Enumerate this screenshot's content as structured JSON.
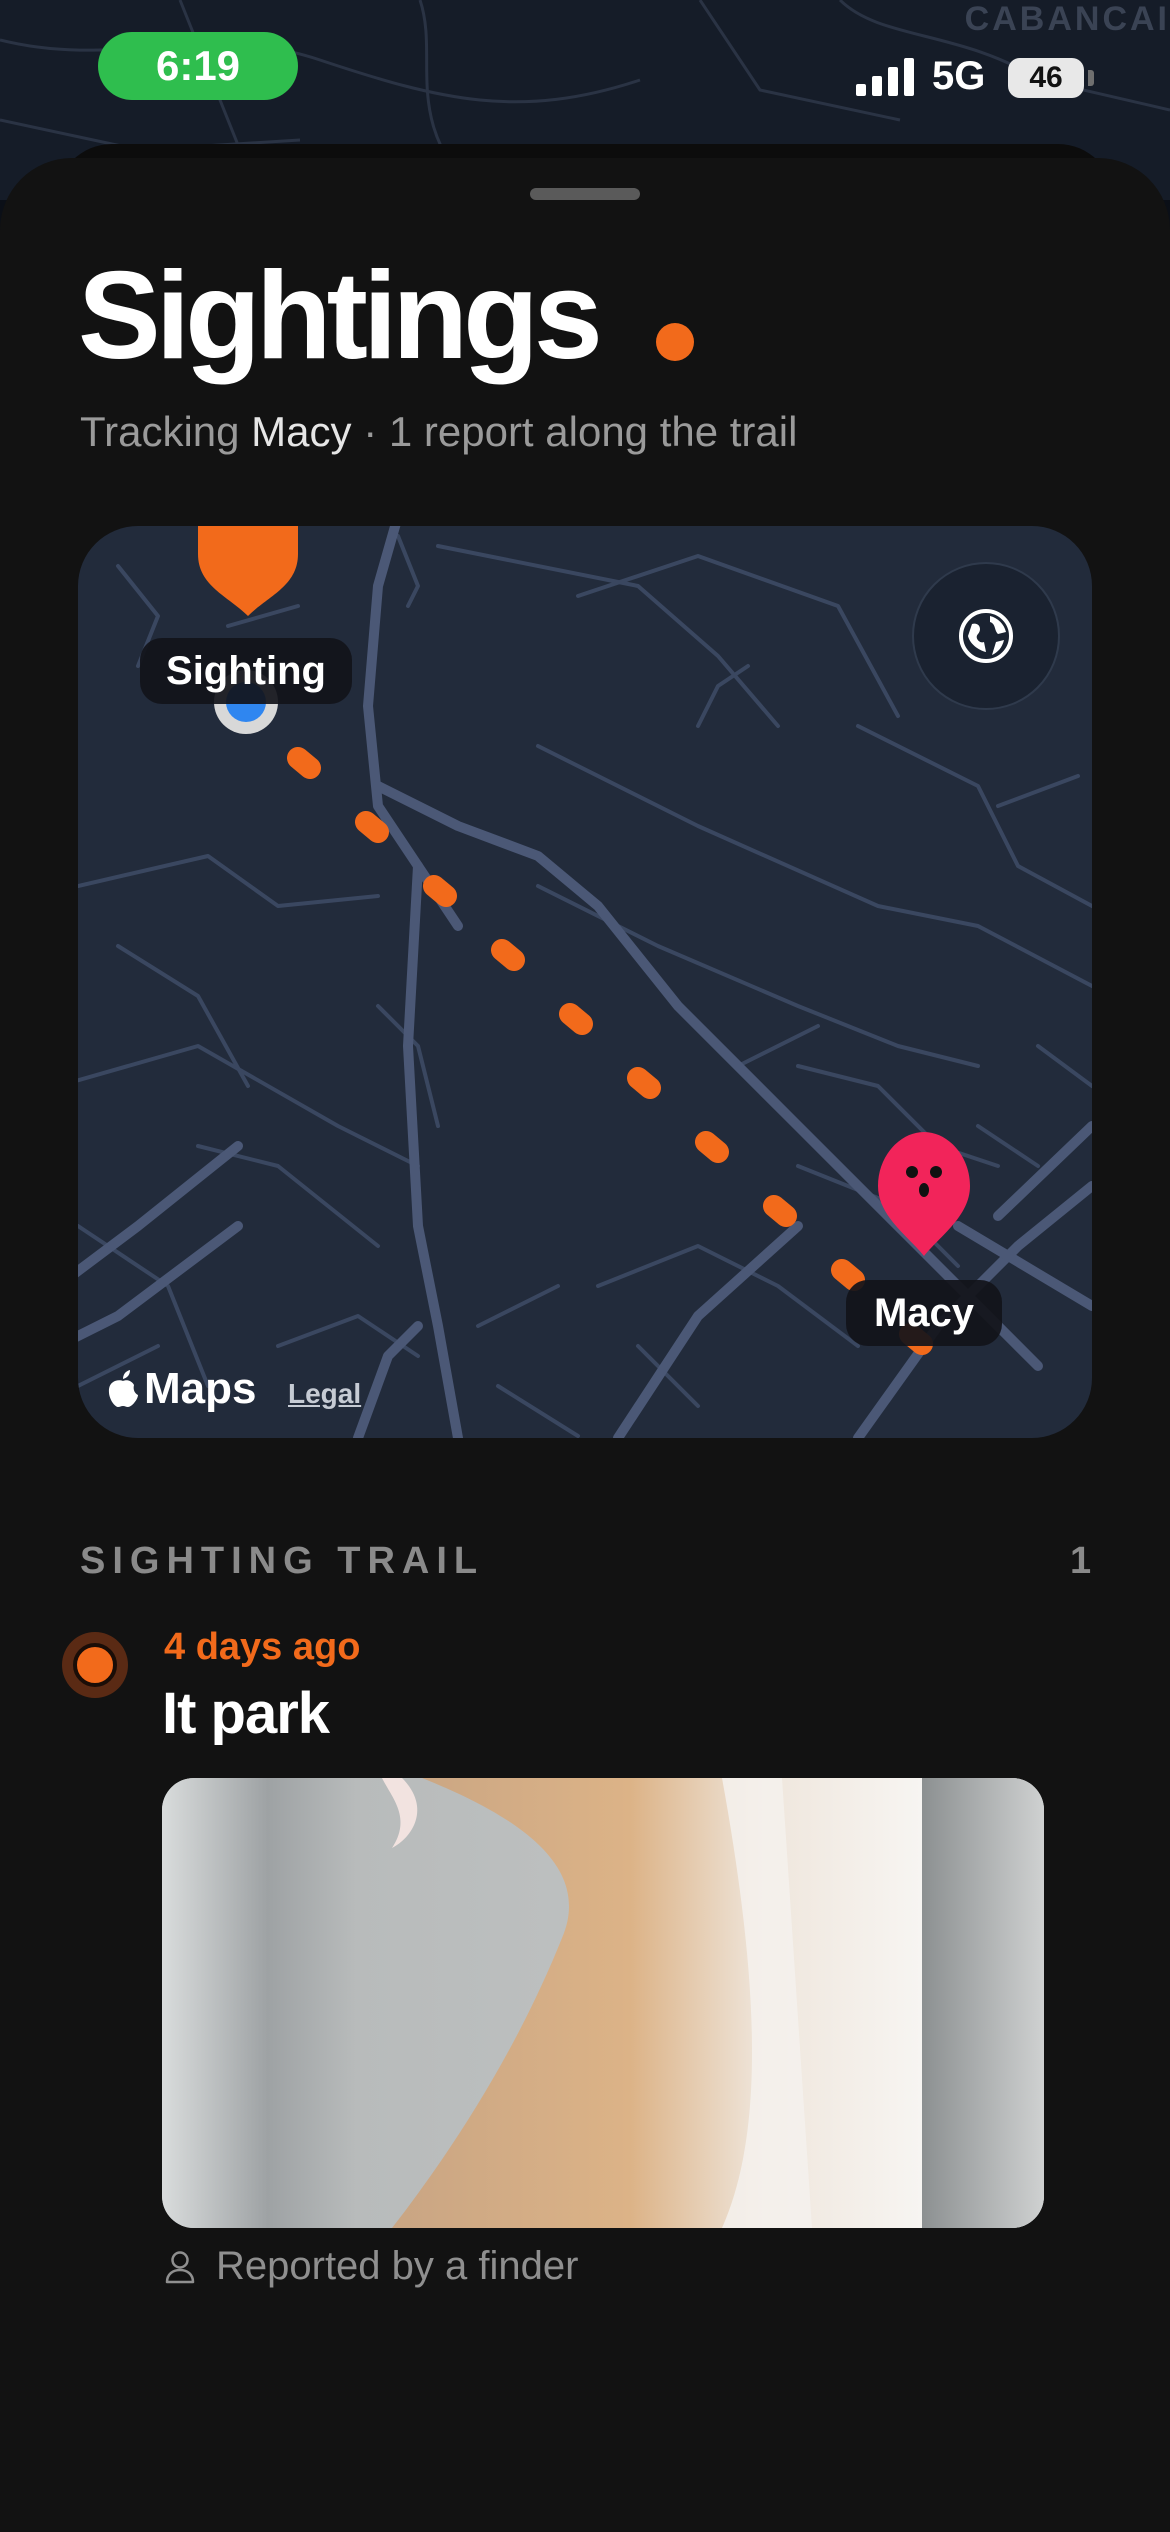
{
  "status_bar": {
    "time": "6:19",
    "network": "5G",
    "battery": "46"
  },
  "background_map": {
    "place_label": "CABANCAI"
  },
  "header": {
    "title": "Sightings",
    "subtitle_prefix": "Tracking ",
    "pet_name": "Macy",
    "subtitle_suffix": " · 1 report along the trail"
  },
  "map": {
    "sighting_label": "Sighting",
    "pet_label": "Macy",
    "attribution": "Maps",
    "legal_link": "Legal",
    "globe_button_icon": "globe-icon",
    "colors": {
      "trail": "#f26a1b",
      "sighting_pin": "#f26a1b",
      "pet_pin": "#f2245a",
      "location_dot": "#2f86f0"
    }
  },
  "trail": {
    "section_title": "SIGHTING TRAIL",
    "count": "1",
    "items": [
      {
        "time_ago": "4 days ago",
        "location": "It park",
        "reporter": "Reported by a finder",
        "reporter_icon": "person-icon"
      }
    ]
  },
  "accent_color": "#f26a1b"
}
